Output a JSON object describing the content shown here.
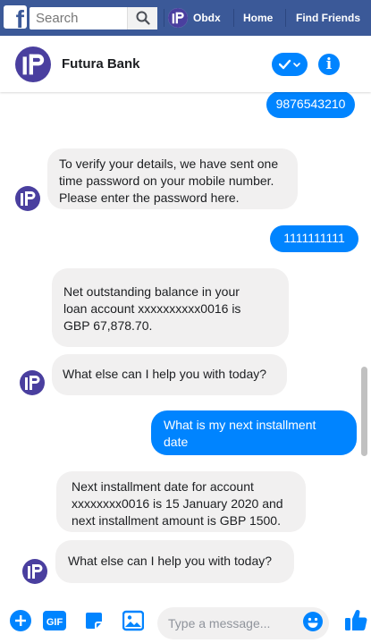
{
  "facebook_bar": {
    "logo_glyph": "f",
    "search_placeholder": "Search",
    "user_name": "Obdx",
    "nav": [
      "Home",
      "Find Friends"
    ],
    "color": "#3b5998"
  },
  "chat_header": {
    "title": "Futura Bank",
    "action_icon": "check-chevron-icon",
    "info_icon": "info-icon",
    "info_glyph": "i"
  },
  "messages": [
    {
      "sender": "user",
      "lines": [
        "9876543210"
      ]
    },
    {
      "sender": "bot",
      "lines": [
        "To verify your details, we have sent one",
        "time password on your mobile number.",
        "Please enter the password here."
      ]
    },
    {
      "sender": "user",
      "lines": [
        "1111111111"
      ]
    },
    {
      "sender": "bot",
      "lines": [
        "Net outstanding balance in your",
        "loan account xxxxxxxxxx0016 is",
        "GBP 67,878.70."
      ]
    },
    {
      "sender": "bot",
      "lines": [
        "What else can I help you with today?"
      ]
    },
    {
      "sender": "user",
      "lines": [
        "What is my next installment",
        "date"
      ]
    },
    {
      "sender": "bot",
      "lines": [
        "Next installment date for account",
        "xxxxxxxx0016 is 15 January 2020 and",
        "next installment amount is GBP 1500."
      ]
    },
    {
      "sender": "bot",
      "lines": [
        "What else can I help you with today?"
      ]
    }
  ],
  "composer": {
    "placeholder": "Type a message...",
    "icons": [
      "plus-icon",
      "gif-icon",
      "sticker-icon",
      "image-icon",
      "emoji-icon",
      "thumbs-up-icon"
    ],
    "gif_label": "GIF"
  },
  "colors": {
    "accent": "#0084ff",
    "bot_bubble": "#f1f0f0",
    "brand_purple": "#4a3f9f"
  }
}
